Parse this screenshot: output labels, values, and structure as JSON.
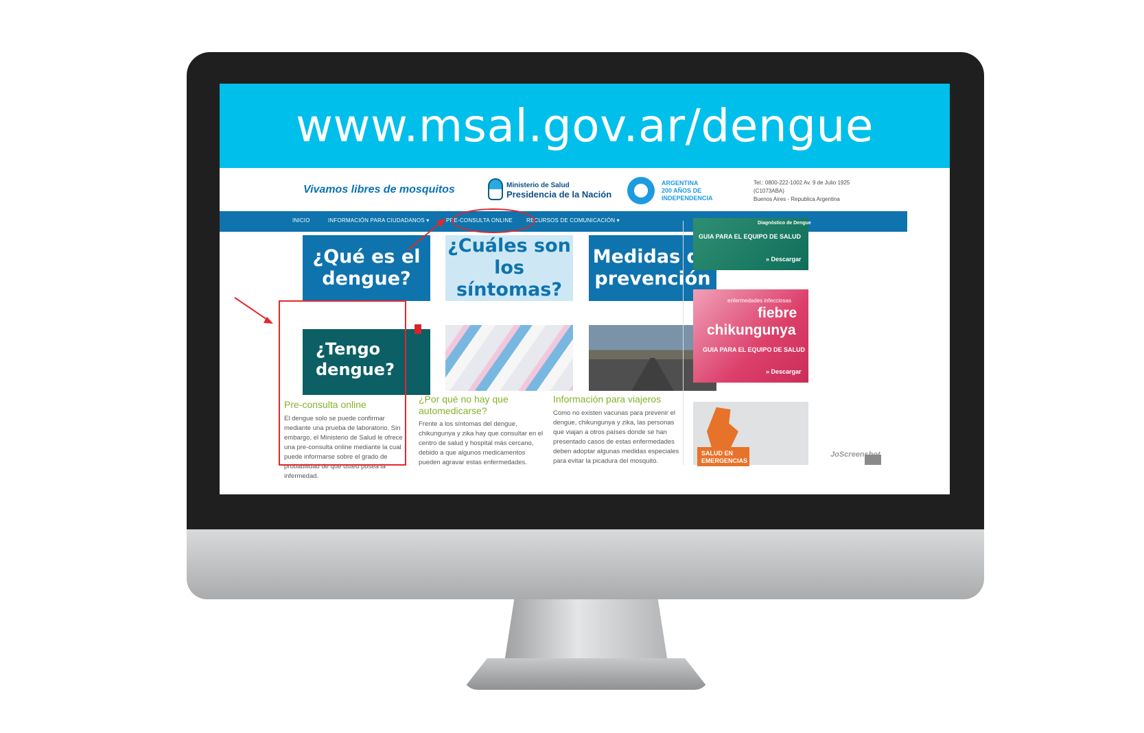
{
  "banner": {
    "url": "www.msal.gov.ar/dengue"
  },
  "header": {
    "slogan_pre": "Vivamos ",
    "slogan_bold": "libres de mosquitos",
    "ministry_line1": "Ministerio de Salud",
    "ministry_line2": "Presidencia de la Nación",
    "bicent_line1": "ARGENTINA",
    "bicent_line2": "200 AÑOS DE",
    "bicent_line3": "INDEPENDENCIA",
    "contact_line1": "Tel.: 0800-222-1002 Av. 9 de Julio 1925",
    "contact_line2": "(C1073ABA)",
    "contact_line3": "Buenos Aires - Republica Argentina"
  },
  "nav": {
    "items": [
      {
        "label": "INICIO"
      },
      {
        "label": "INFORMACIÓN PARA CIUDADANOS ▾"
      },
      {
        "label": "PRE-CONSULTA ONLINE"
      },
      {
        "label": "RECURSOS DE COMUNICACIÓN ▾"
      }
    ]
  },
  "tiles": [
    {
      "line1": "¿Qué es el",
      "line2": "dengue?"
    },
    {
      "line1": "¿Cuáles son",
      "line2": "los síntomas?"
    },
    {
      "line1": "Medidas de",
      "line2": "prevención"
    }
  ],
  "cards": [
    {
      "image_text_1": "¿Tengo",
      "image_text_2": "dengue?",
      "title": "Pre-consulta online",
      "text": "El dengue solo se puede confirmar mediante una prueba de laboratorio. Sin embargo, el Ministerio de Salud le ofrece una pre-consulta online mediante la cual puede informarse sobre el grado de probabilidad de que usted posea la infermedad."
    },
    {
      "title": "¿Por qué no hay que automedicarse?",
      "text": "Frente a los síntomas del dengue, chikungunya y zika hay que consultar en el centro de salud y hospital más cercano, debido a que algunos medicamentos pueden agravar estas enfermedades."
    },
    {
      "title": "Información para viajeros",
      "text": "Como no existen vacunas para prevenir el dengue, chikungunya y zika, las personas que viajan a otros países donde se han presentado casos de estas enfermedades deben adoptar algunas medidas especiales para evitar la picadura del mosquito."
    }
  ],
  "sidebar": {
    "box1_caption": "Diagnóstico de Dengue",
    "box1_title": "GUIA PARA EL EQUIPO DE SALUD",
    "box1_link": "» Descargar",
    "box2_caption": "enfermedades infecciosas",
    "box2_title1": "fiebre",
    "box2_title2": "chikungunya",
    "box2_sub": "GUIA PARA EL EQUIPO DE SALUD",
    "box2_link": "» Descargar",
    "box3_line1": "SALUD EN",
    "box3_line2": "EMERGENCIAS"
  },
  "watermark": "JoScreenshot",
  "colors": {
    "banner": "#00bfea",
    "nav": "#0f73ad",
    "card_title": "#85b22a",
    "annotation": "#e5262a"
  }
}
